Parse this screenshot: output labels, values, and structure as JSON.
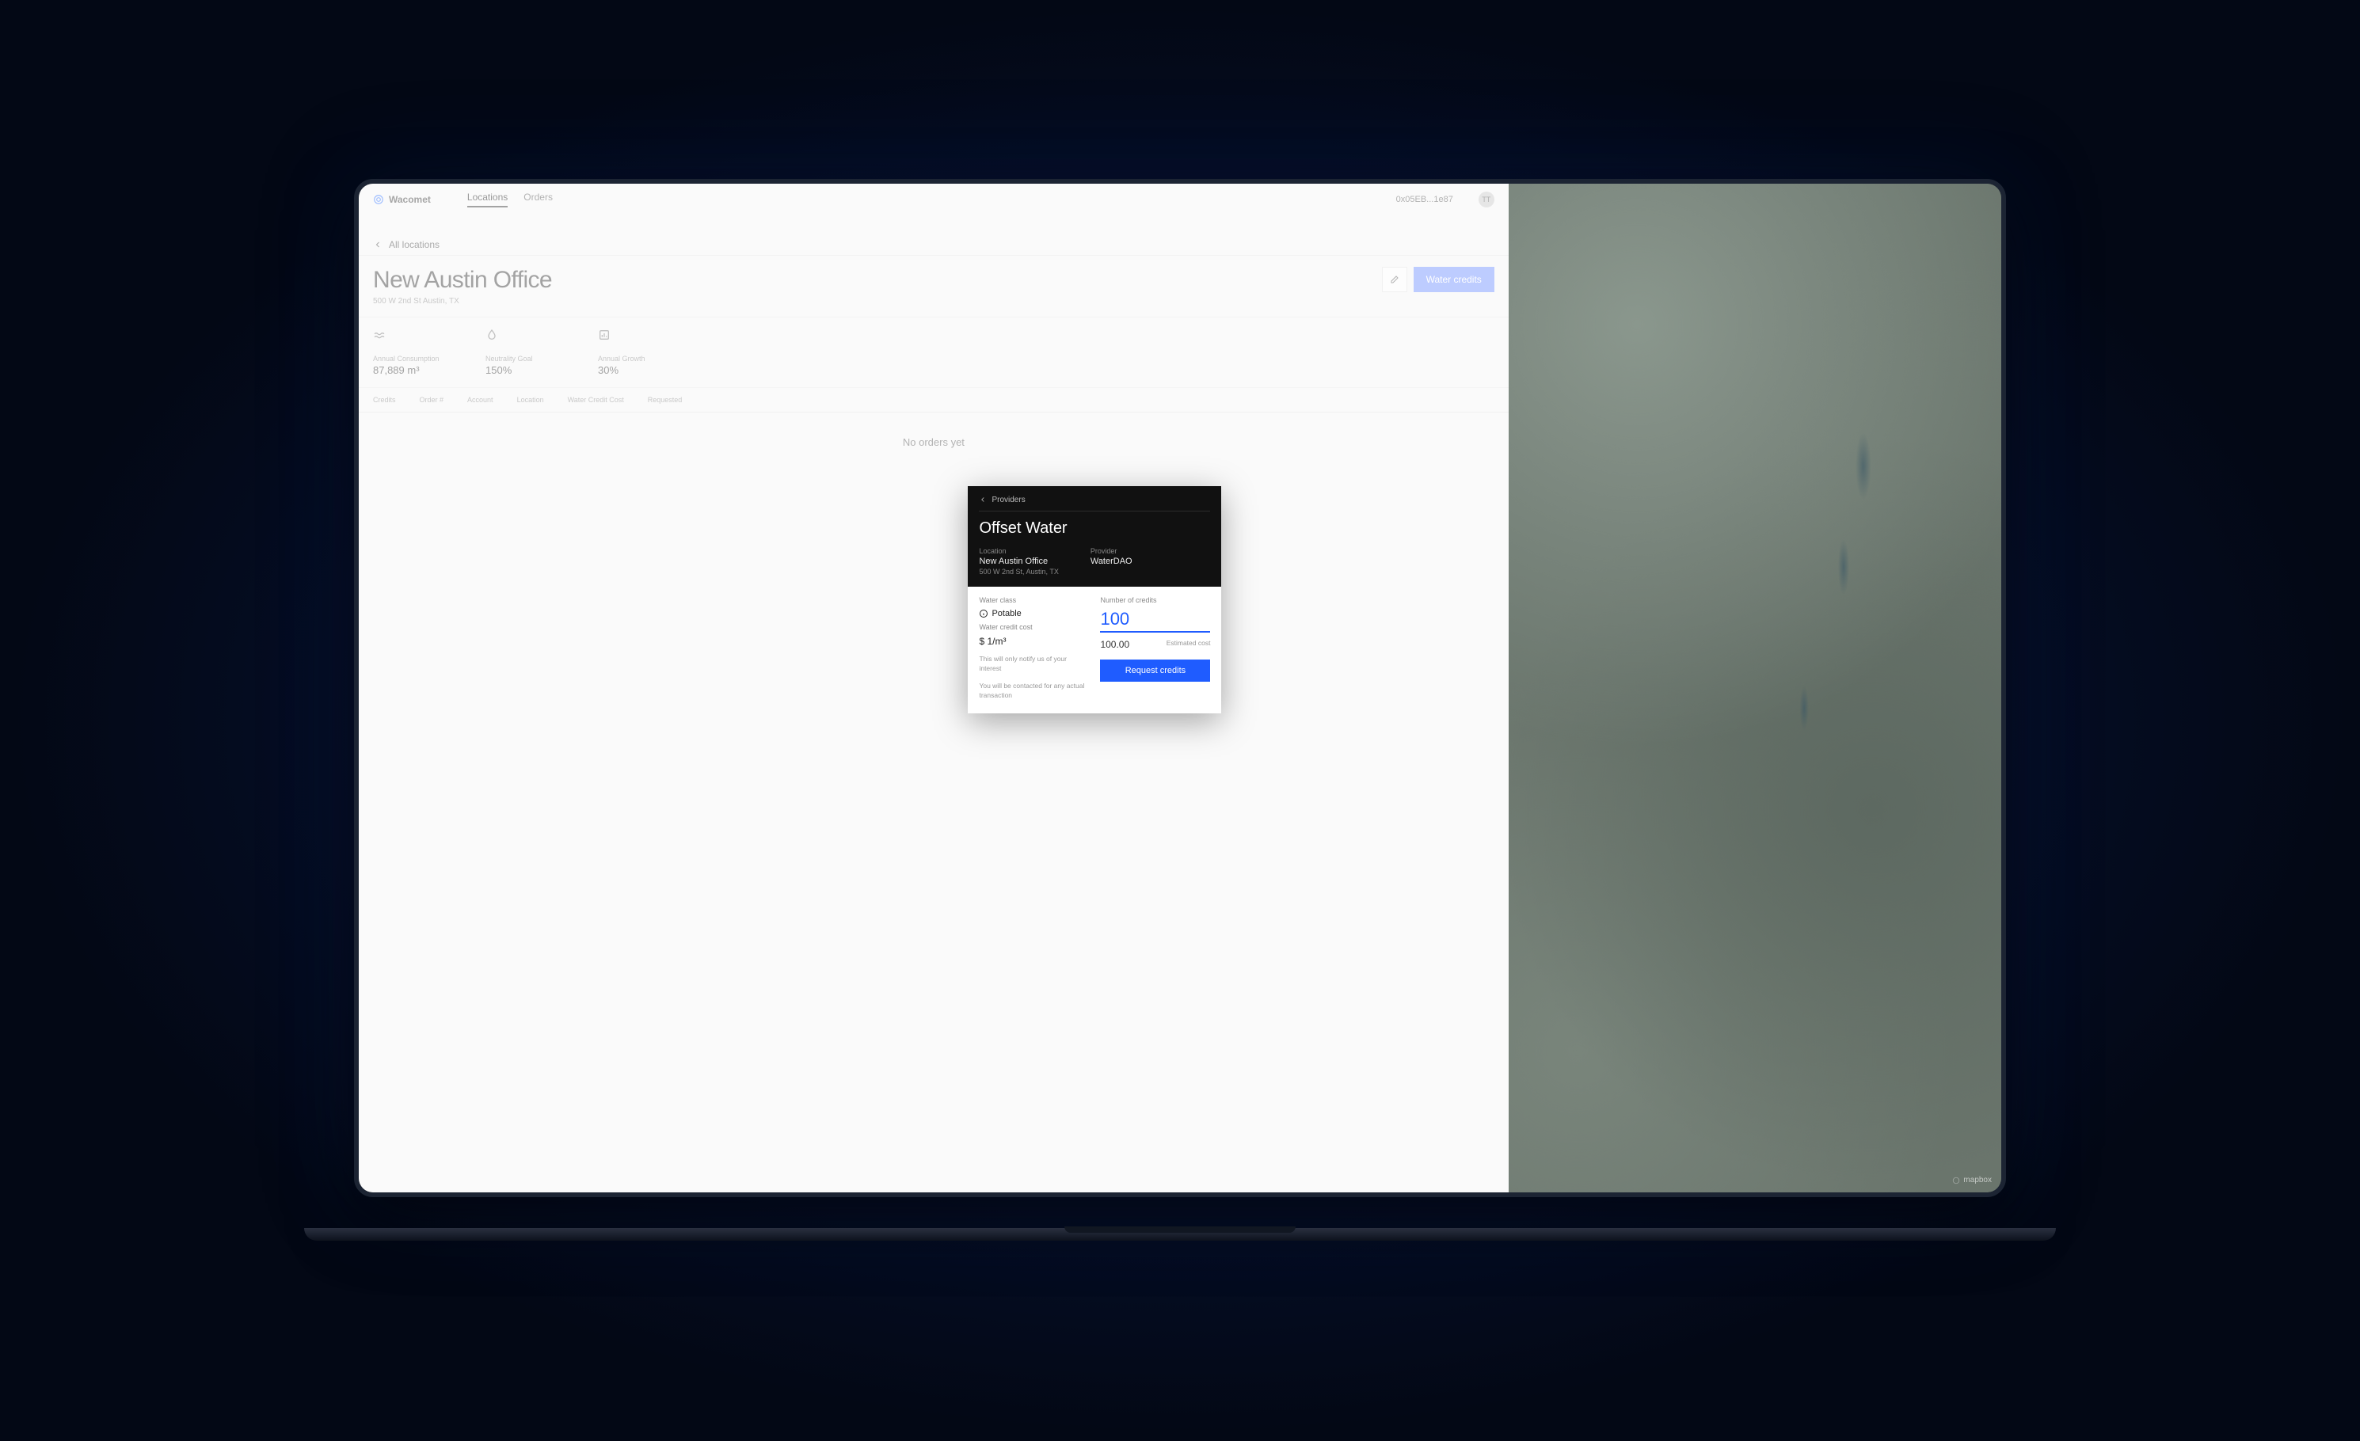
{
  "brand": "Wacomet",
  "nav": {
    "locations": "Locations",
    "orders": "Orders"
  },
  "wallet": "0x05EB...1e87",
  "avatar": "TT",
  "crumb": "All locations",
  "page": {
    "title": "New Austin Office",
    "address": "500 W 2nd St Austin, TX"
  },
  "actions": {
    "water_credits": "Water credits"
  },
  "stats": {
    "consumption": {
      "label": "Annual Consumption",
      "value": "87,889 m³"
    },
    "neutrality": {
      "label": "Neutrality Goal",
      "value": "150%"
    },
    "growth": {
      "label": "Annual Growth",
      "value": "30%"
    }
  },
  "table": {
    "headers": [
      "Credits",
      "Order #",
      "Account",
      "Location",
      "Water Credit Cost",
      "Requested"
    ],
    "empty": "No orders yet"
  },
  "map_attrib": "mapbox",
  "modal": {
    "crumb": "Providers",
    "title": "Offset Water",
    "location_label": "Location",
    "location_name": "New Austin Office",
    "location_addr": "500 W 2nd St, Austin, TX",
    "provider_label": "Provider",
    "provider_name": "WaterDAO",
    "water_class_label": "Water class",
    "water_class_value": "Potable",
    "credit_cost_label": "Water credit cost",
    "credit_cost_value": "$ 1/m³",
    "note1": "This will only notify us of your interest",
    "note2": "You will be contacted for any actual transaction",
    "num_credits_label": "Number of credits",
    "num_credits_value": "100",
    "estimated_cost_label": "Estimated cost",
    "estimated_cost_value": "100.00",
    "request_btn": "Request credits"
  }
}
